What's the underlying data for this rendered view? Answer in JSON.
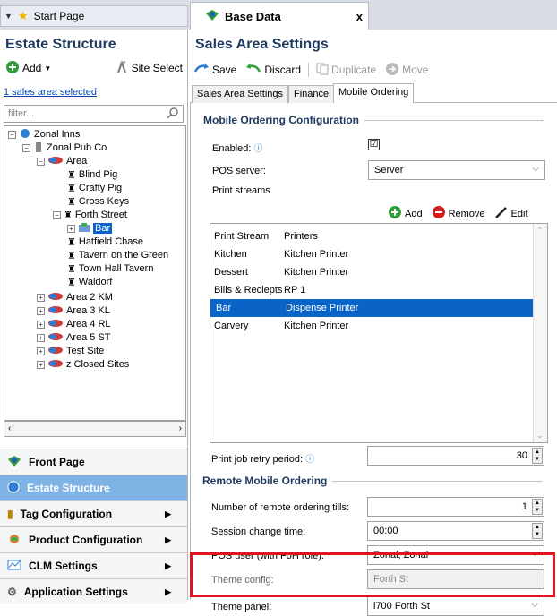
{
  "tabs": {
    "start": "Start Page",
    "base": "Base Data",
    "close": "x"
  },
  "left": {
    "title": "Estate Structure",
    "add_label": "Add",
    "site_select_label": "Site Select",
    "selection_link": "1 sales area selected",
    "filter_placeholder": "filter...",
    "tree": {
      "root": "Zonal Inns",
      "company": "Zonal Pub Co",
      "area": "Area",
      "sites": [
        "Blind Pig",
        "Crafty Pig",
        "Cross Keys",
        "Forth Street"
      ],
      "selected": "Bar",
      "sites2": [
        "Hatfield Chase",
        "Tavern on the Green",
        "Town Hall Tavern",
        "Waldorf"
      ],
      "areas": [
        "Area 2 KM",
        "Area 3 KL",
        "Area 4 RL",
        "Area 5 ST",
        "Test Site",
        "z Closed Sites"
      ]
    },
    "nav": [
      "Front Page",
      "Estate Structure",
      "Tag Configuration",
      "Product Configuration",
      "CLM Settings",
      "Application Settings"
    ]
  },
  "right": {
    "title": "Sales Area Settings",
    "toolbar": {
      "save": "Save",
      "discard": "Discard",
      "duplicate": "Duplicate",
      "move": "Move"
    },
    "subtabs": [
      "Sales Area Settings",
      "Finance",
      "Mobile Ordering"
    ],
    "mobile_section": "Mobile Ordering Configuration",
    "enabled_label": "Enabled:",
    "enabled_check": "☑",
    "pos_server_label": "POS server:",
    "pos_server_value": "Server",
    "print_streams_label": "Print streams",
    "grid_actions": {
      "add": "Add",
      "remove": "Remove",
      "edit": "Edit"
    },
    "grid_headers": [
      "Print Stream",
      "Printers"
    ],
    "grid_rows": [
      [
        "Kitchen",
        "Kitchen Printer"
      ],
      [
        "Dessert",
        "Kitchen Printer"
      ],
      [
        "Bills & Reciepts",
        "RP 1"
      ],
      [
        "Bar",
        "Dispense Printer"
      ],
      [
        "Carvery",
        "Kitchen Printer"
      ]
    ],
    "retry_label": "Print job retry period:",
    "retry_value": "30",
    "remote_section": "Remote Mobile Ordering",
    "remote_tills_label": "Number of remote ordering tills:",
    "remote_tills_value": "1",
    "session_label": "Session change time:",
    "session_value": "00:00",
    "pos_user_label": "POS user (with FoH role):",
    "pos_user_value": "Zonal, Zonal",
    "theme_config_label": "Theme config:",
    "theme_config_value": "Forth St",
    "theme_panel_label": "Theme panel:",
    "theme_panel_value": "i700 Forth St"
  },
  "colors": {
    "accent": "#0a64c8",
    "highlight": "#e0151c",
    "header": "#1f3a5f"
  }
}
